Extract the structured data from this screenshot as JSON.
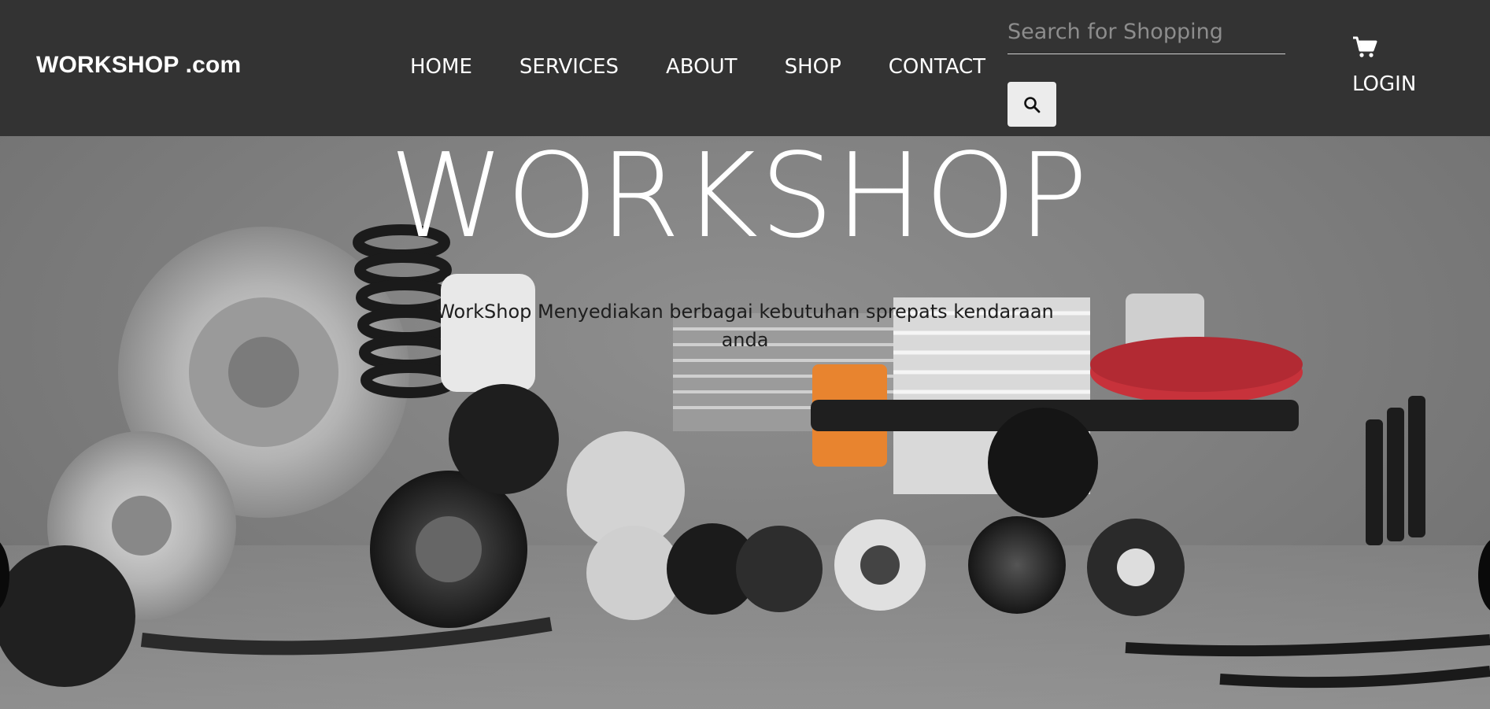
{
  "header": {
    "brand": "WORKSHOP .com",
    "nav": [
      {
        "label": "HOME"
      },
      {
        "label": "SERVICES"
      },
      {
        "label": "ABOUT"
      },
      {
        "label": "SHOP"
      },
      {
        "label": "CONTACT"
      }
    ],
    "search": {
      "placeholder": "Search for Shopping",
      "value": "",
      "button_icon": "search-icon"
    },
    "cart_icon": "cart-icon",
    "login_label": "LOGIN"
  },
  "hero": {
    "title": "WORKSHOP",
    "subtitle": "WorkShop Menyediakan berbagai kebutuhan sprepats kendaraan anda",
    "image": "auto-parts-photo",
    "prev_icon": "carousel-prev",
    "next_icon": "carousel-next"
  },
  "colors": {
    "navbar_bg": "#333333",
    "nav_text": "#ffffff",
    "search_placeholder": "#8d8d8d",
    "search_button_bg": "#ececec",
    "hero_title": "#ffffff",
    "hero_subtitle": "#1e1e1e"
  }
}
